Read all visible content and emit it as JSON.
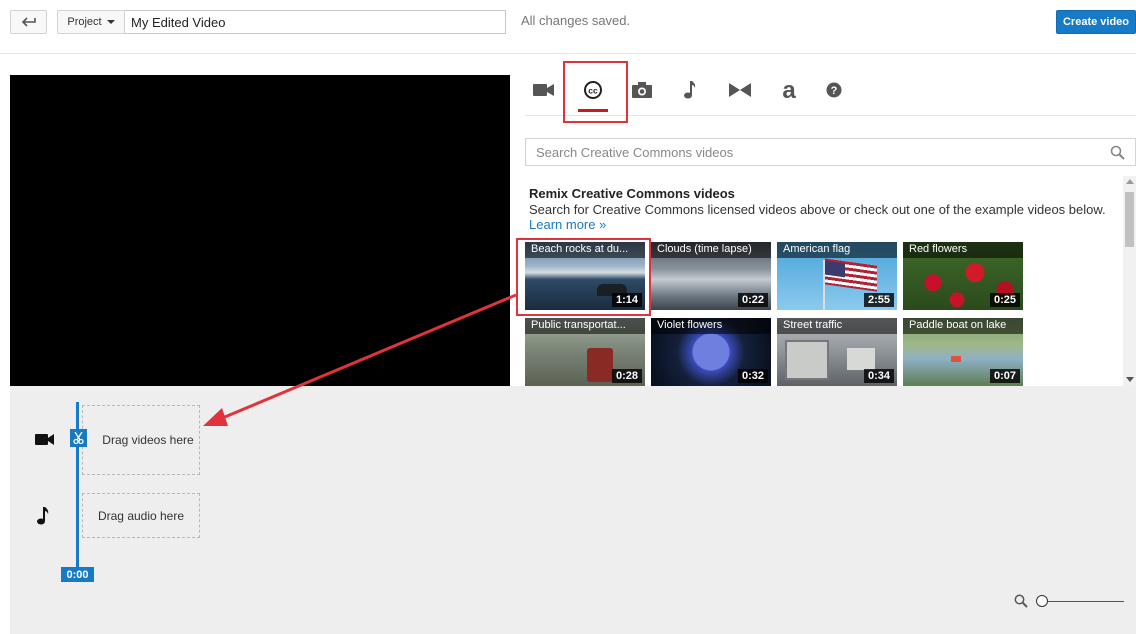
{
  "header": {
    "back_icon": "back-arrow-icon",
    "project_label": "Project",
    "title_value": "My Edited Video",
    "save_status": "All changes saved.",
    "create_label": "Create video",
    "accent_color": "#167ac6"
  },
  "tabs": [
    {
      "icon": "video-camera-icon",
      "active": false
    },
    {
      "icon": "creative-commons-icon",
      "active": true
    },
    {
      "icon": "photo-camera-icon",
      "active": false
    },
    {
      "icon": "music-note-icon",
      "active": false
    },
    {
      "icon": "transitions-icon",
      "active": false
    },
    {
      "icon": "text-icon",
      "active": false
    },
    {
      "icon": "help-icon",
      "active": false
    }
  ],
  "search": {
    "placeholder": "Search Creative Commons videos"
  },
  "library": {
    "title": "Remix Creative Commons videos",
    "description": "Search for Creative Commons licensed videos above or check out one of the example videos below.",
    "link": "Learn more »",
    "videos": [
      {
        "title": "Beach rocks at du...",
        "duration": "1:14"
      },
      {
        "title": "Clouds (time lapse)",
        "duration": "0:22"
      },
      {
        "title": "American flag",
        "duration": "2:55"
      },
      {
        "title": "Red flowers",
        "duration": "0:25"
      },
      {
        "title": "Public transportat...",
        "duration": "0:28"
      },
      {
        "title": "Violet flowers",
        "duration": "0:32"
      },
      {
        "title": "Street traffic",
        "duration": "0:34"
      },
      {
        "title": "Paddle boat on lake",
        "duration": "0:07"
      }
    ]
  },
  "timeline": {
    "video_drop": "Drag videos here",
    "audio_drop": "Drag audio here",
    "playhead_time": "0:00"
  },
  "annotation_color": "#e0333a"
}
